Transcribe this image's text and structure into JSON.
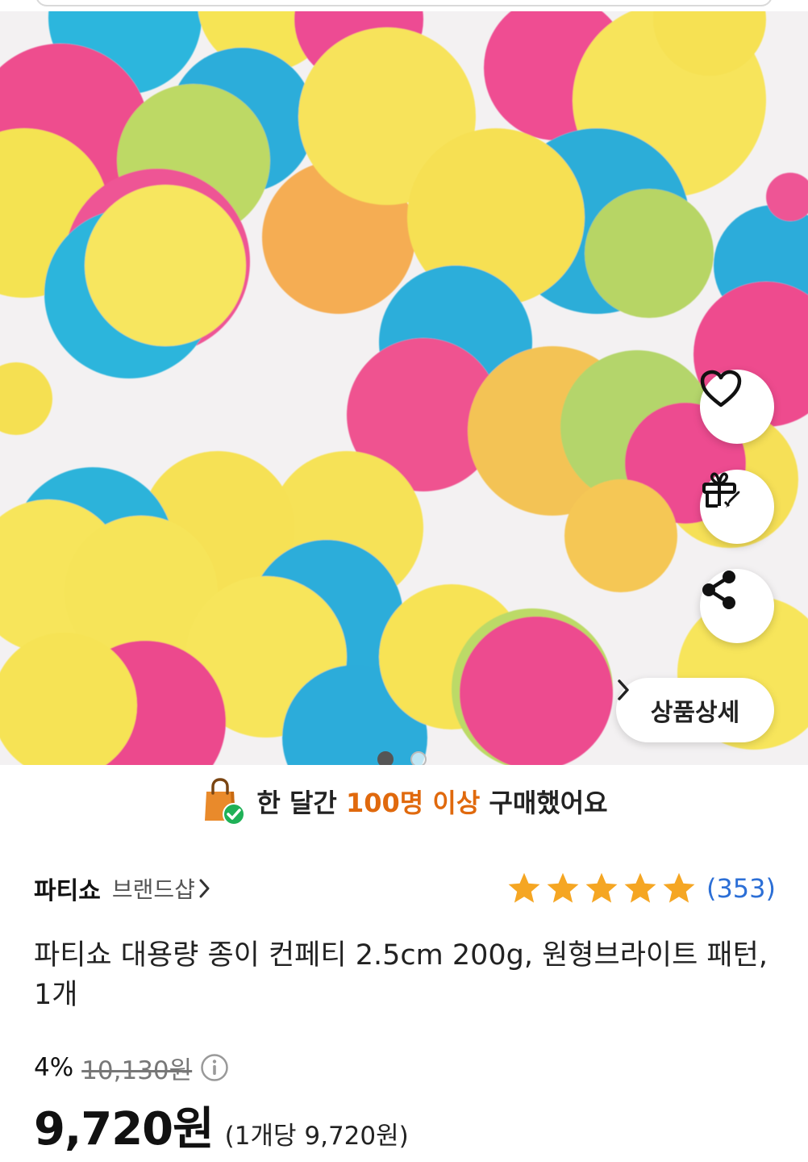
{
  "hero": {
    "image_description_icon": "confetti-product-photo",
    "pagination": {
      "current": 1,
      "total": 2
    }
  },
  "actions": {
    "wishlist_icon": "heart-outline-icon",
    "gift_icon": "gift-rocket-icon",
    "share_icon": "share-icon"
  },
  "detail_button": {
    "label": "상품상세",
    "chevron": "›"
  },
  "purchase_banner": {
    "prefix": "한 달간 ",
    "highlight": "100명 이상",
    "suffix": " 구매했어요",
    "highlight_color": "#e0690d"
  },
  "brand": {
    "name": "파티쇼",
    "shop_label": "브랜드샵",
    "chevron": "›"
  },
  "rating": {
    "stars": 5,
    "max": 5,
    "review_count": "(353)",
    "star_color": "#f5a623"
  },
  "product": {
    "title": "파티쇼 대용량 종이 컨페티 2.5cm 200g, 원형브라이트 패턴, 1개"
  },
  "price": {
    "discount_rate": "4%",
    "original_price": "10,130원",
    "final_price": "9,720원",
    "unit_price": "(1개당 9,720원)"
  }
}
